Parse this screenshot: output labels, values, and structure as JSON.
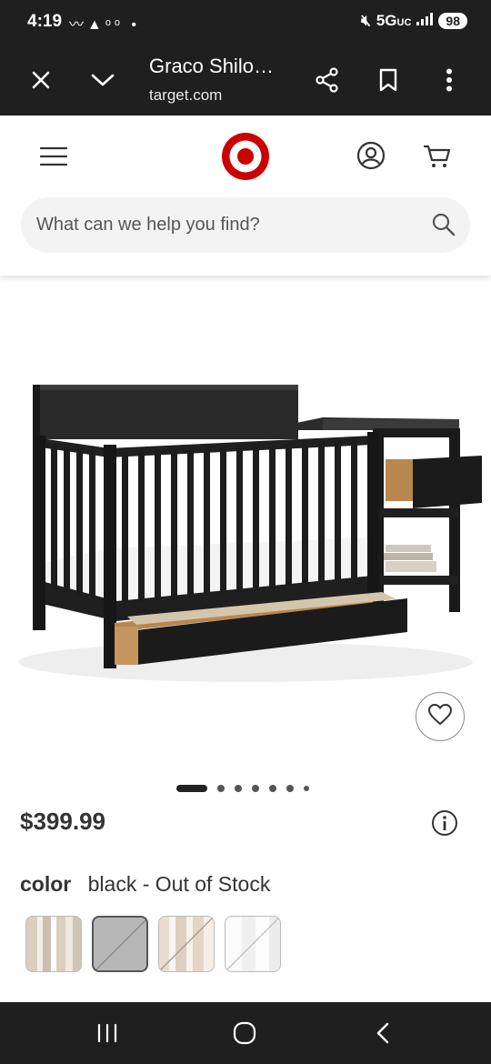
{
  "status_bar": {
    "time": "4:19",
    "network": "5G",
    "network_sub": "UC",
    "battery": "98"
  },
  "browser": {
    "title": "Graco Shilo…",
    "url": "target.com"
  },
  "header": {
    "brand": "Target"
  },
  "search": {
    "placeholder": "What can we help you find?"
  },
  "gallery": {
    "image_count": 7,
    "active_index": 0
  },
  "product": {
    "price": "$399.99"
  },
  "variant": {
    "label": "color",
    "selected_value": "black - Out of Stock",
    "swatches": [
      {
        "name": "beige-stripe",
        "selected": false
      },
      {
        "name": "gray",
        "selected": true
      },
      {
        "name": "natural-stripe",
        "selected": false
      },
      {
        "name": "white",
        "selected": false
      }
    ]
  },
  "colors": {
    "brand_red": "#cc0000",
    "dark_bar": "#1f1f1f",
    "price_text": "#333333"
  }
}
